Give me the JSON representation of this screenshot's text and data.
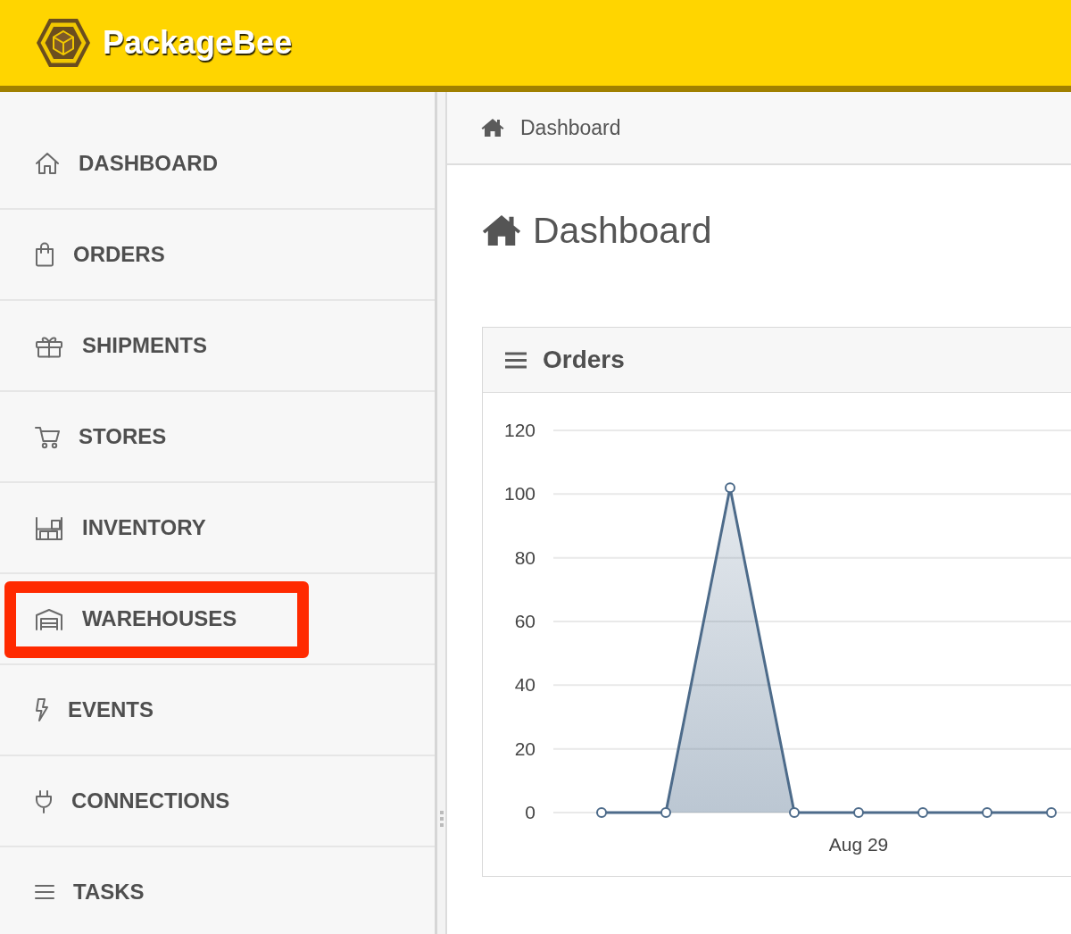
{
  "header": {
    "brand": "PackageBee"
  },
  "sidebar": {
    "items": [
      {
        "label": "DASHBOARD",
        "highlighted": false
      },
      {
        "label": "ORDERS",
        "highlighted": false
      },
      {
        "label": "SHIPMENTS",
        "highlighted": false
      },
      {
        "label": "STORES",
        "highlighted": false
      },
      {
        "label": "INVENTORY",
        "highlighted": false
      },
      {
        "label": "WAREHOUSES",
        "highlighted": true
      },
      {
        "label": "EVENTS",
        "highlighted": false
      },
      {
        "label": "CONNECTIONS",
        "highlighted": false
      },
      {
        "label": "TASKS",
        "highlighted": false
      }
    ]
  },
  "breadcrumb": {
    "label": "Dashboard"
  },
  "page_title": "Dashboard",
  "orders_card": {
    "chart_data": {
      "type": "area",
      "title": "Orders",
      "categories": [
        null,
        null,
        null,
        null,
        "Aug 29",
        null,
        null,
        null
      ],
      "ylim": [
        0,
        120
      ],
      "yticks": [
        0,
        20,
        40,
        60,
        80,
        100,
        120
      ],
      "grid": true,
      "series": [
        {
          "color": "#4d6b8a",
          "values": [
            0,
            0,
            102,
            0,
            0,
            0,
            0,
            0
          ]
        }
      ]
    }
  }
}
